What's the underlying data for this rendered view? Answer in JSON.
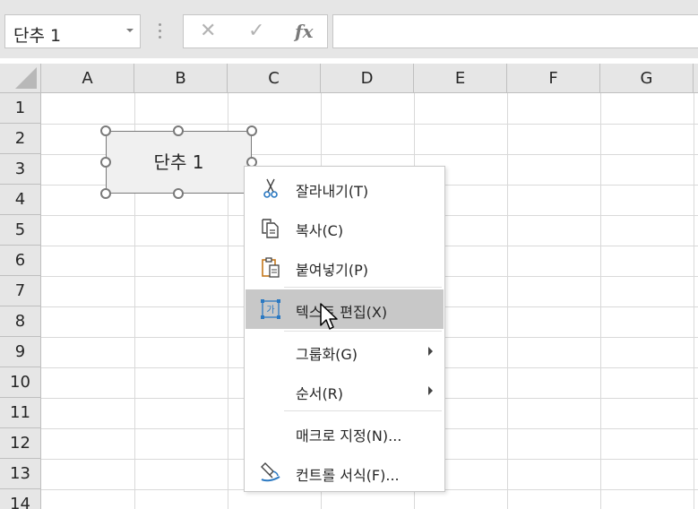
{
  "formula_bar": {
    "name_box_value": "단추 1",
    "cancel_icon": "✕",
    "enter_icon": "✓",
    "fx_label": "fx",
    "formula_value": ""
  },
  "columns": [
    "A",
    "B",
    "C",
    "D",
    "E",
    "F",
    "G"
  ],
  "rows": [
    "1",
    "2",
    "3",
    "4",
    "5",
    "6",
    "7",
    "8",
    "9",
    "10",
    "11",
    "12",
    "13",
    "14"
  ],
  "form_button": {
    "label": "단추 1"
  },
  "context_menu": {
    "items": [
      {
        "label": "잘라내기(T)",
        "icon": "scissors-icon"
      },
      {
        "label": "복사(C)",
        "icon": "copy-icon"
      },
      {
        "label": "붙여넣기(P)",
        "icon": "paste-icon"
      },
      {
        "label": "텍스트 편집(X)",
        "icon": "edit-text-icon"
      },
      {
        "label": "그룹화(G)",
        "icon": "",
        "submenu": true
      },
      {
        "label": "순서(R)",
        "icon": "",
        "submenu": true
      },
      {
        "label": "매크로 지정(N)...",
        "icon": ""
      },
      {
        "label": "컨트롤 서식(F)...",
        "icon": "format-control-icon"
      }
    ]
  },
  "colors": {
    "accent": "#217346",
    "icon_blue": "#2b79c2",
    "highlight": "#c8c8c8"
  }
}
